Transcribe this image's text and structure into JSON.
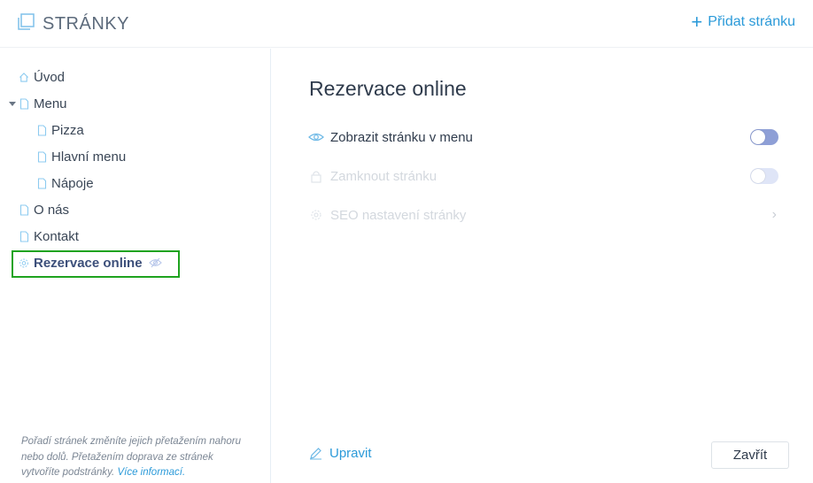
{
  "header": {
    "title": "STRÁNKY",
    "add_page_label": "Přidat stránku",
    "add_icon": "plus-icon",
    "logo_icon": "pages-icon"
  },
  "sidebar": {
    "items": [
      {
        "label": "Úvod",
        "icon": "home-icon",
        "level": 0
      },
      {
        "label": "Menu",
        "icon": "page-icon",
        "level": 0,
        "expanded": true
      },
      {
        "label": "Pizza",
        "icon": "page-icon",
        "level": 1
      },
      {
        "label": "Hlavní menu",
        "icon": "page-icon",
        "level": 1
      },
      {
        "label": "Nápoje",
        "icon": "page-icon",
        "level": 1
      },
      {
        "label": "O nás",
        "icon": "page-icon",
        "level": 0
      },
      {
        "label": "Kontakt",
        "icon": "page-icon",
        "level": 0
      },
      {
        "label": "Rezervace online",
        "icon": "gear-icon",
        "level": 0,
        "active": true,
        "hidden_badge": "eye-off-icon"
      }
    ],
    "hint_text": "Pořadí stránek změníte jejich přetažením nahoru nebo dolů. Přetažením doprava ze stránek vytvoříte podstránky.",
    "hint_link": "Více informací."
  },
  "main": {
    "page_title": "Rezervace online",
    "options": [
      {
        "label": "Zobrazit stránku v menu",
        "icon": "eye-icon",
        "control": "toggle",
        "on": false,
        "disabled": false
      },
      {
        "label": "Zamknout stránku",
        "icon": "lock-icon",
        "control": "toggle",
        "on": false,
        "disabled": true
      },
      {
        "label": "SEO nastavení stránky",
        "icon": "seo-icon",
        "control": "chevron",
        "disabled": true
      }
    ],
    "chevron": "›",
    "edit_label": "Upravit",
    "close_label": "Zavřít"
  },
  "colors": {
    "accent": "#2b9ad9",
    "toggle": "#8e9fd6",
    "highlight": "#1fa31f",
    "active_text": "#3c4f7a"
  }
}
